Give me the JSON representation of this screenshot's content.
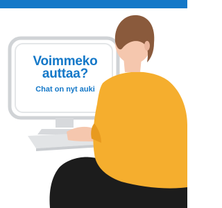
{
  "chat_banner": {
    "headline_line1": "Voimmeko",
    "headline_line2": "auttaa?",
    "subline": "Chat on nyt auki"
  },
  "colors": {
    "accent_blue": "#1478c8",
    "shirt_yellow": "#f5ae2e",
    "hair_brown": "#8a5a3c",
    "skin": "#f5c7ae",
    "trousers": "#1c1c1c",
    "monitor_grey": "#d7d9dc"
  }
}
